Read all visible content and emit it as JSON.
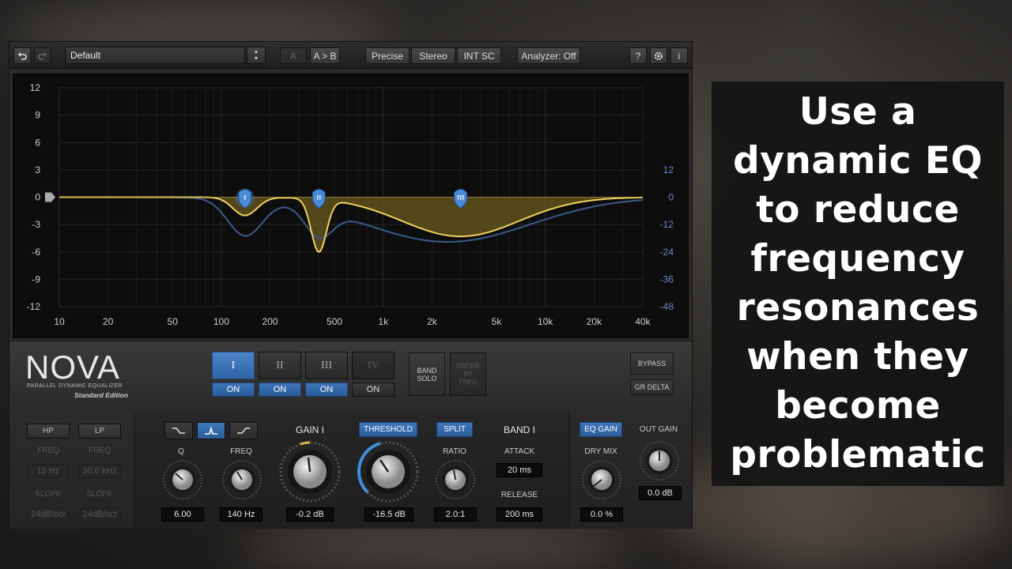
{
  "toolbar": {
    "undo_icon": "undo-icon",
    "redo_icon": "redo-icon",
    "preset": "Default",
    "ab_a": "A",
    "ab_swap": "A > B",
    "precise": "Precise",
    "stereo": "Stereo",
    "int_sc": "INT SC",
    "analyzer": "Analyzer: Off",
    "help": "?",
    "info": "i"
  },
  "graph": {
    "y_left_ticks": [
      "12",
      "9",
      "6",
      "3",
      "0",
      "-3",
      "-6",
      "-9",
      "-12"
    ],
    "y_right_ticks": [
      "12",
      "0",
      "-12",
      "-24",
      "-36",
      "-48"
    ],
    "x_ticks": [
      "10",
      "20",
      "50",
      "100",
      "200",
      "500",
      "1k",
      "2k",
      "5k",
      "10k",
      "20k",
      "40k"
    ],
    "band_handles": [
      "I",
      "II",
      "III"
    ],
    "colors": {
      "curve": "#f0d060",
      "fill": "#6b5a1e",
      "static_curve": "#3b5a8a"
    }
  },
  "nova": {
    "logo": "NOVA",
    "subtitle": "PARALLEL DYNAMIC EQUALIZER",
    "edition": "Standard Edition",
    "bands": [
      {
        "label": "I",
        "on": "ON"
      },
      {
        "label": "II",
        "on": "ON"
      },
      {
        "label": "III",
        "on": "ON"
      },
      {
        "label": "IV",
        "on": "ON"
      }
    ],
    "band_solo_1": "BAND",
    "band_solo_2": "SOLO",
    "order_1": "ORDER",
    "order_2": "BY",
    "order_3": "FREQ",
    "bypass": "BYPASS",
    "gr_delta": "GR DELTA"
  },
  "controls": {
    "hp": "HP",
    "lp": "LP",
    "hp_freq_label": "FREQ",
    "lp_freq_label": "FREQ",
    "hp_freq": "15 Hz",
    "lp_freq": "30.0 kHz",
    "hp_slope_label": "SLOPE",
    "lp_slope_label": "SLOPE",
    "hp_slope": "24dB/oct",
    "lp_slope": "24dB/oct",
    "q_label": "Q",
    "q_value": "6.00",
    "freq_label": "FREQ",
    "freq_value": "140 Hz",
    "gain_label": "GAIN I",
    "gain_value": "-0.2 dB",
    "threshold_label": "THRESHOLD",
    "threshold_value": "-16.5 dB",
    "split_label": "SPLIT",
    "ratio_label": "RATIO",
    "ratio_value": "2.0:1",
    "band_title": "BAND I",
    "attack_label": "ATTACK",
    "attack_value": "20 ms",
    "release_label": "RELEASE",
    "release_value": "200 ms",
    "eq_gain_label": "EQ GAIN",
    "dry_mix_label": "DRY MIX",
    "dry_mix_value": "0.0 %",
    "out_gain_label": "OUT GAIN",
    "out_gain_value": "0.0 dB"
  },
  "caption": {
    "lines": [
      "Use a",
      "dynamic EQ",
      "to reduce",
      "frequency",
      "resonances",
      "when they",
      "become",
      "problematic"
    ]
  }
}
